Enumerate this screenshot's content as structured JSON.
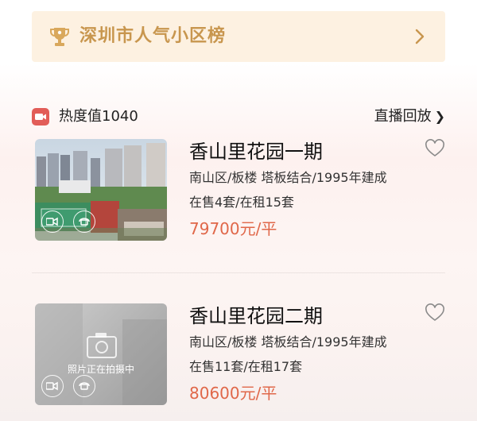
{
  "banner": {
    "title": "深圳市人气小区榜",
    "trophy_icon": "trophy-icon",
    "accent": "#c8964e"
  },
  "hot": {
    "label": "热度值1040",
    "replay": "直播回放"
  },
  "listings": [
    {
      "name": "香山里花园一期",
      "meta": "南山区/板楼 塔板结合/1995年建成",
      "availability": "在售4套/在租15套",
      "price": "79700元/平"
    },
    {
      "name": "香山里花园二期",
      "meta": "南山区/板楼 塔板结合/1995年建成",
      "availability": "在售11套/在租17套",
      "price": "80600元/平",
      "thumb_caption": "照片正在拍摄中"
    }
  ]
}
